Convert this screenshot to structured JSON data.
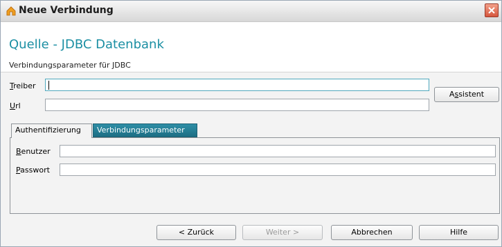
{
  "window": {
    "title": "Neue Verbindung",
    "icon": "app-icon",
    "close_icon": "close-icon"
  },
  "header": {
    "title": "Quelle - JDBC Datenbank",
    "subtitle": "Verbindungsparameter für JDBC"
  },
  "form": {
    "driver_label_underlined": "T",
    "driver_label_rest": "reiber",
    "driver_value": "",
    "url_label_underlined": "U",
    "url_label_rest": "rl",
    "url_value": "",
    "assistant_button_pre": "A",
    "assistant_button_underlined": "s",
    "assistant_button_rest": "sistent"
  },
  "tabs": [
    {
      "label": "Authentifizierung",
      "active": true
    },
    {
      "label": "Verbindungsparameter",
      "active": false
    }
  ],
  "auth": {
    "user_label_underlined": "B",
    "user_label_rest": "enutzer",
    "user_value": "",
    "password_label_underlined": "P",
    "password_label_rest": "asswort",
    "password_value": ""
  },
  "footer": {
    "back_label": "< Zurück",
    "next_label": "Weiter >",
    "cancel_label": "Abbrechen",
    "help_label": "Hilfe"
  },
  "colors": {
    "accent": "#1b8fa3",
    "tab_inactive": "#2a86a0",
    "close_red": "#d5563d"
  }
}
